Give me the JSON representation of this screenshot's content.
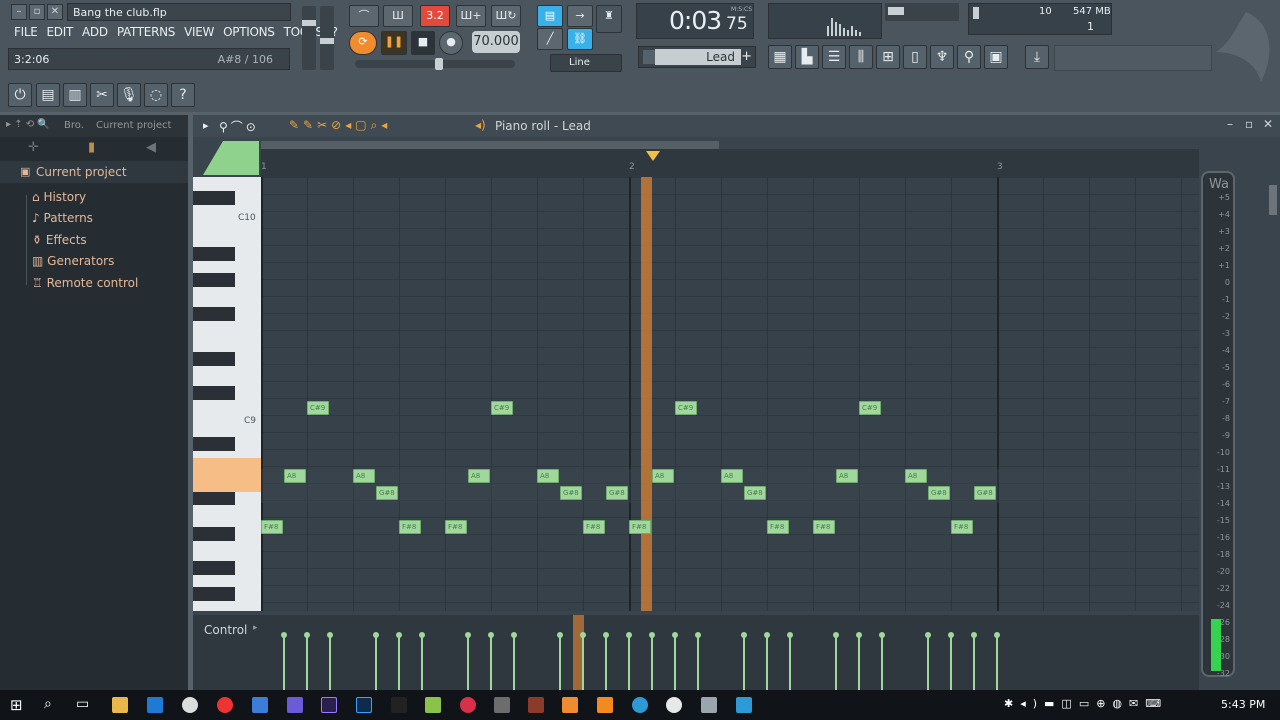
{
  "window": {
    "filename": "Bang the club.flp",
    "position": "3:2:06",
    "note_info": "A#8 / 106"
  },
  "menu": [
    "FILE",
    "EDIT",
    "ADD",
    "PATTERNS",
    "VIEW",
    "OPTIONS",
    "TOOLS",
    "?"
  ],
  "transport": {
    "tempo": "70.000",
    "time": "0:03",
    "time_frac": "75",
    "time_format": "M:S:CS",
    "pattern_label": "3.2",
    "snap": "Line",
    "channel": "Lead",
    "cpu": "10",
    "memory": "547 MB",
    "polyphony": "1"
  },
  "browser": {
    "header_short": "Bro.",
    "header_title": "Current project",
    "items": [
      "Current project",
      "History",
      "Patterns",
      "Effects",
      "Generators",
      "Remote control"
    ]
  },
  "piano_roll": {
    "title": "Piano roll - Lead",
    "bar_labels": [
      "1",
      "2",
      "3"
    ],
    "key_labels": [
      "C10",
      "C9"
    ],
    "control_label": "Control",
    "meter_label": "Wa",
    "meter_ticks": [
      "+5",
      "+4",
      "+3",
      "+2",
      "+1",
      "0",
      "-1",
      "-2",
      "-3",
      "-4",
      "-5",
      "-6",
      "-7",
      "-8",
      "-9",
      "-10",
      "-11",
      "-13",
      "-14",
      "-15",
      "-16",
      "-18",
      "-20",
      "-22",
      "-24",
      "-26",
      "-28",
      "-30",
      "-32"
    ],
    "notes": [
      {
        "label": "F#8",
        "beat": 0,
        "row": "F#8"
      },
      {
        "label": "A8",
        "beat": 0.5,
        "row": "A8"
      },
      {
        "label": "C#9",
        "beat": 1,
        "row": "C#9"
      },
      {
        "label": "A8",
        "beat": 2,
        "row": "A8"
      },
      {
        "label": "G#8",
        "beat": 2.5,
        "row": "G#8"
      },
      {
        "label": "F#8",
        "beat": 3,
        "row": "F#8"
      },
      {
        "label": "F#8",
        "beat": 4,
        "row": "F#8"
      },
      {
        "label": "A8",
        "beat": 4.5,
        "row": "A8"
      },
      {
        "label": "C#9",
        "beat": 5,
        "row": "C#9"
      },
      {
        "label": "A8",
        "beat": 6,
        "row": "A8"
      },
      {
        "label": "G#8",
        "beat": 6.5,
        "row": "G#8"
      },
      {
        "label": "F#8",
        "beat": 7,
        "row": "F#8"
      },
      {
        "label": "G#8",
        "beat": 7.5,
        "row": "G#8"
      },
      {
        "label": "F#8",
        "beat": 8,
        "row": "F#8"
      },
      {
        "label": "A8",
        "beat": 8.5,
        "row": "A8"
      },
      {
        "label": "C#9",
        "beat": 9,
        "row": "C#9"
      },
      {
        "label": "A8",
        "beat": 10,
        "row": "A8"
      },
      {
        "label": "G#8",
        "beat": 10.5,
        "row": "G#8"
      },
      {
        "label": "F#8",
        "beat": 11,
        "row": "F#8"
      },
      {
        "label": "F#8",
        "beat": 12,
        "row": "F#8"
      },
      {
        "label": "A8",
        "beat": 12.5,
        "row": "A8"
      },
      {
        "label": "C#9",
        "beat": 13,
        "row": "C#9"
      },
      {
        "label": "A8",
        "beat": 14,
        "row": "A8"
      },
      {
        "label": "G#8",
        "beat": 14.5,
        "row": "G#8"
      },
      {
        "label": "F#8",
        "beat": 15,
        "row": "F#8"
      },
      {
        "label": "G#8",
        "beat": 15.5,
        "row": "G#8"
      }
    ]
  },
  "taskbar": {
    "clock": "5:43 PM"
  }
}
